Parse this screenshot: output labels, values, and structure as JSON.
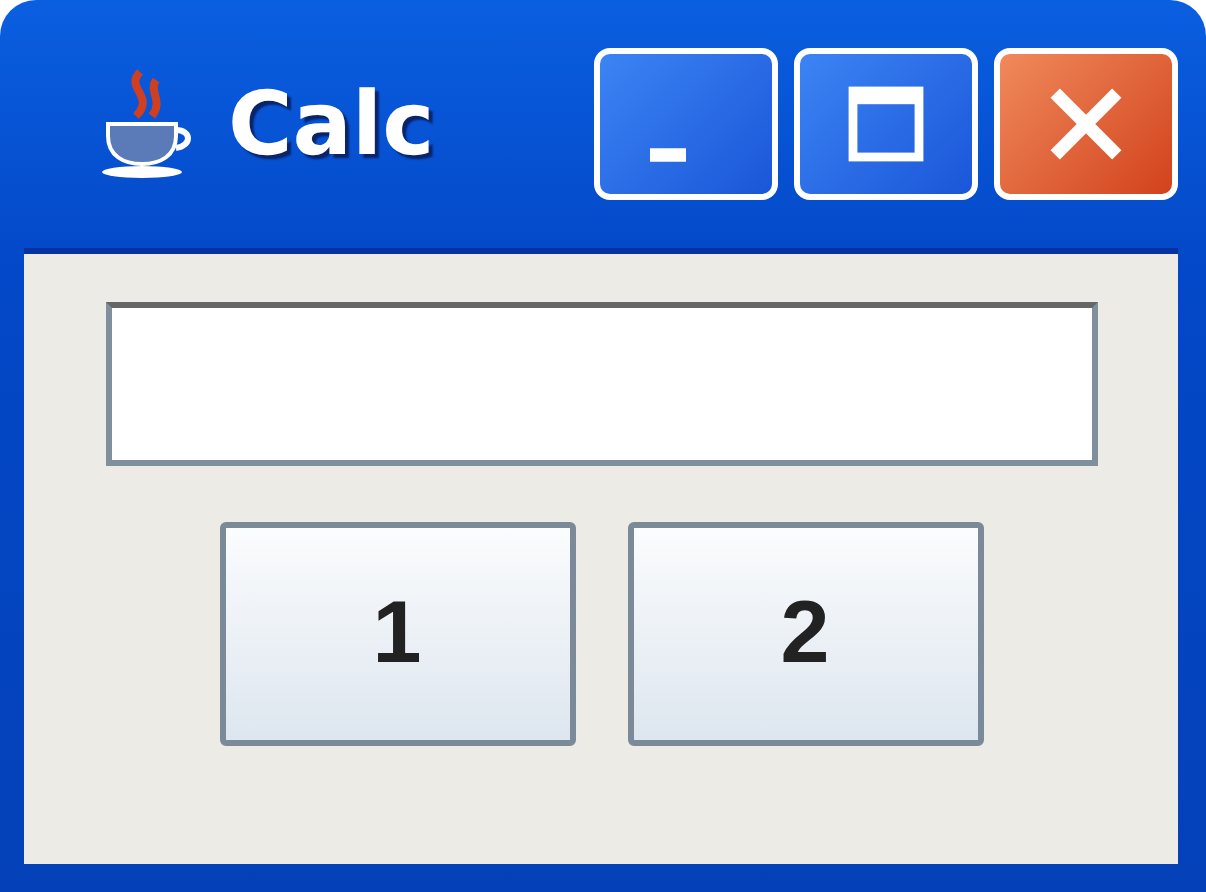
{
  "window": {
    "title": "Calc"
  },
  "buttons": [
    {
      "label": "1"
    },
    {
      "label": "2"
    }
  ]
}
